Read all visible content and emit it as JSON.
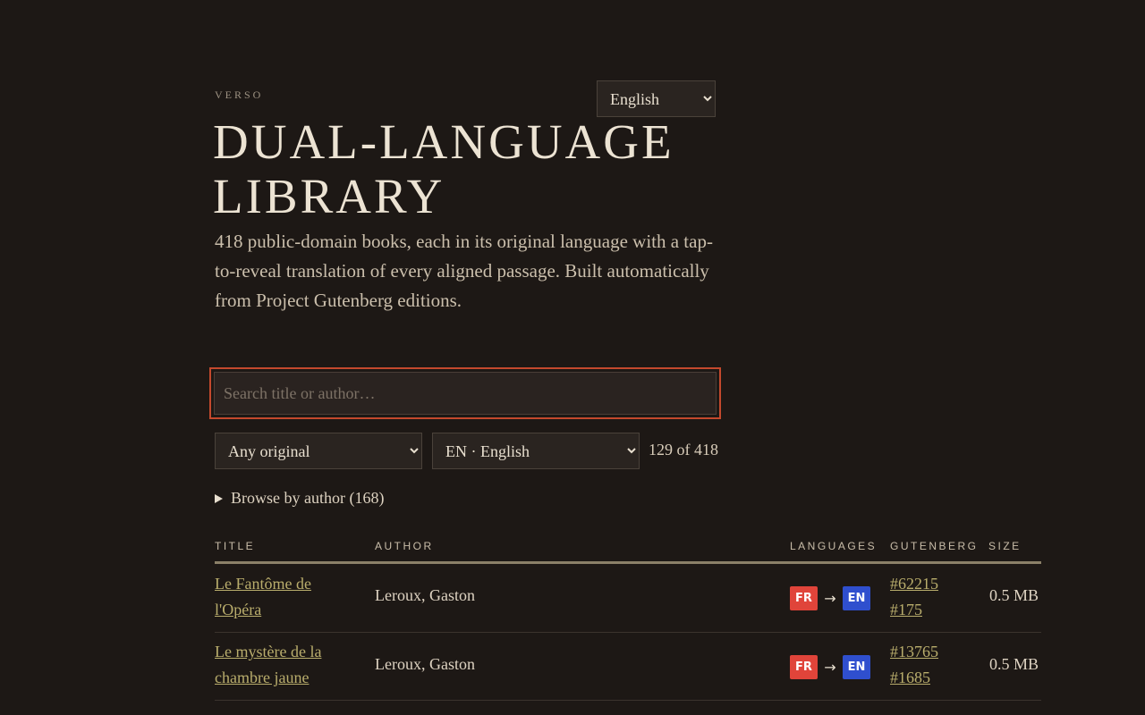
{
  "brand": "VERSO",
  "ui_language": {
    "selected": "English",
    "options": [
      "English"
    ]
  },
  "title": "DUAL-LANGUAGE LIBRARY",
  "intro": "418 public-domain books, each in its original language with a tap-to-reveal translation of every aligned passage. Built automatically from Project Gutenberg editions.",
  "search": {
    "placeholder": "Search title or author…",
    "value": ""
  },
  "filters": {
    "original": {
      "selected": "Any original"
    },
    "target": {
      "selected": "EN · English"
    }
  },
  "count": "129 of 418",
  "browse_label": "Browse by author (168)",
  "table": {
    "headers": {
      "title": "TITLE",
      "author": "AUTHOR",
      "languages": "LANGUAGES",
      "gutenberg": "GUTENBERG",
      "size": "SIZE"
    },
    "rows": [
      {
        "title": "Le Fantôme de l'Opéra",
        "author": "Leroux, Gaston",
        "source_lang": "FR",
        "target_lang": "EN",
        "arrow": "→",
        "gutenberg_ids": [
          "#62215",
          "#175"
        ],
        "size": "0.5 MB"
      },
      {
        "title": "Le mystère de la chambre jaune",
        "author": "Leroux, Gaston",
        "source_lang": "FR",
        "target_lang": "EN",
        "arrow": "→",
        "gutenberg_ids": [
          "#13765",
          "#1685"
        ],
        "size": "0.5 MB"
      }
    ]
  },
  "colors": {
    "background": "#1d1815",
    "accent_focus": "#c4492d",
    "link": "#b9ad6c",
    "badge_source": "#e0443a",
    "badge_target": "#2f4fce"
  }
}
